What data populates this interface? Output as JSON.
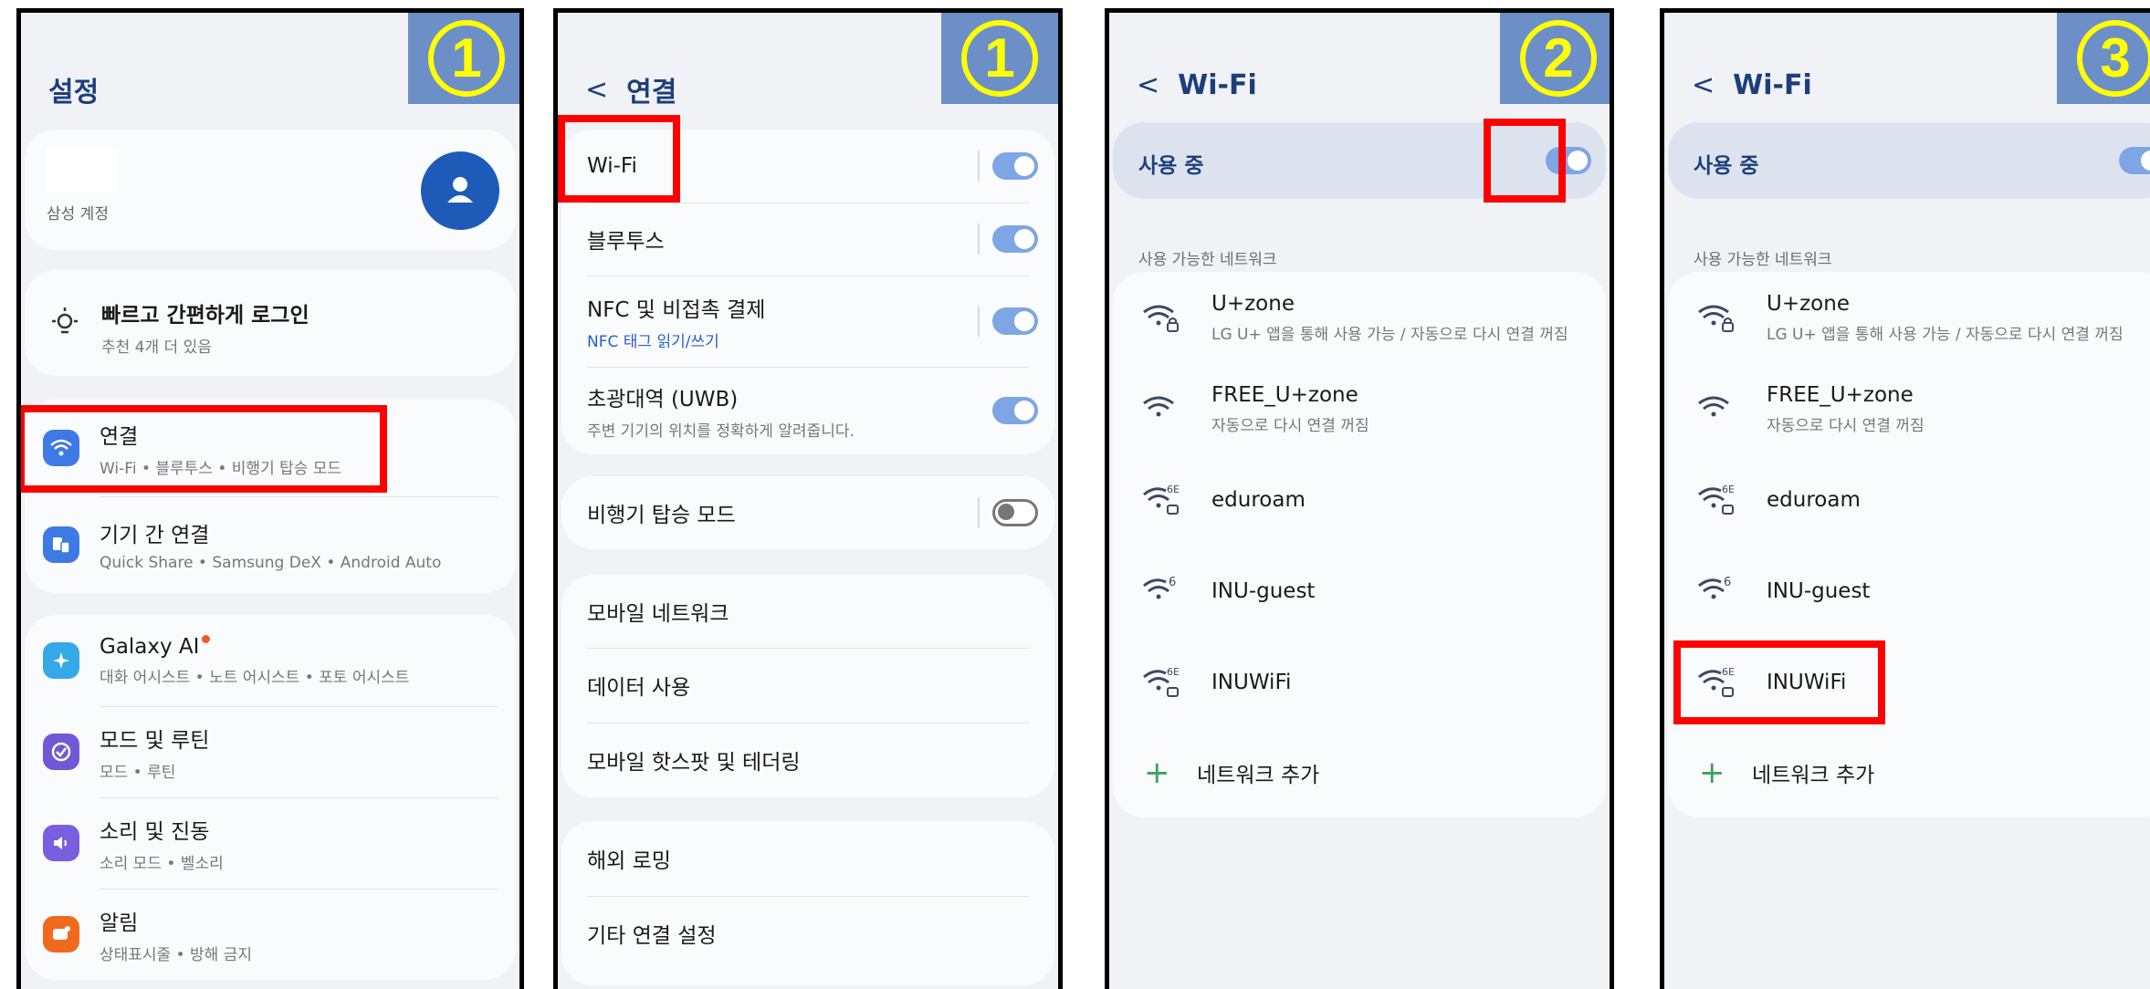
{
  "steps": {
    "s1": "1",
    "s2": "1",
    "s3": "2",
    "s4": "3"
  },
  "screen1": {
    "title": "설정",
    "account_label": "삼성 계정",
    "suggest_title": "빠르고 간편하게 로그인",
    "suggest_sub": "추천 4개 더 있음",
    "items": [
      {
        "label": "연결",
        "sub": "Wi-Fi • 블루투스 • 비행기 탑승 모드"
      },
      {
        "label": "기기 간 연결",
        "sub": "Quick Share • Samsung DeX • Android Auto"
      },
      {
        "label": "Galaxy AI",
        "sub": "대화 어시스트 • 노트 어시스트 • 포토 어시스트"
      },
      {
        "label": "모드 및 루틴",
        "sub": "모드 • 루틴"
      },
      {
        "label": "소리 및 진동",
        "sub": "소리 모드 • 벨소리"
      },
      {
        "label": "알림",
        "sub": "상태표시줄 • 방해 금지"
      }
    ]
  },
  "screen2": {
    "back": "<",
    "title": "연결",
    "wifi": "Wi-Fi",
    "bluetooth": "블루투스",
    "nfc": "NFC 및 비접촉 결제",
    "nfc_sub": "NFC 태그 읽기/쓰기",
    "uwb": "초광대역 (UWB)",
    "uwb_sub": "주변 기기의 위치를 정확하게 알려줍니다.",
    "airplane": "비행기 탑승 모드",
    "mobile_network": "모바일 네트워크",
    "data_usage": "데이터 사용",
    "hotspot": "모바일 핫스팟 및 테더링",
    "roaming": "해외 로밍",
    "other": "기타 연결 설정"
  },
  "screen3": {
    "back": "<",
    "title": "Wi-Fi",
    "in_use": "사용 중",
    "available": "사용 가능한 네트워크",
    "networks": [
      {
        "name": "U+zone",
        "sub": "LG U+ 앱을 통해 사용 가능 / 자동으로 다시 연결 꺼짐",
        "badge": ""
      },
      {
        "name": "FREE_U+zone",
        "sub": "자동으로 다시 연결 꺼짐",
        "badge": ""
      },
      {
        "name": "eduroam",
        "sub": "",
        "badge": "6E"
      },
      {
        "name": "INU-guest",
        "sub": "",
        "badge": "6"
      },
      {
        "name": "INUWiFi",
        "sub": "",
        "badge": "6E"
      }
    ],
    "add": "네트워크 추가"
  },
  "colors": {
    "accent": "#1c3f7a",
    "toggle_on": "#7ea6e4",
    "highlight": "#ff0000",
    "step_bg": "#6c8fc8",
    "step_fg": "#ffff00"
  }
}
